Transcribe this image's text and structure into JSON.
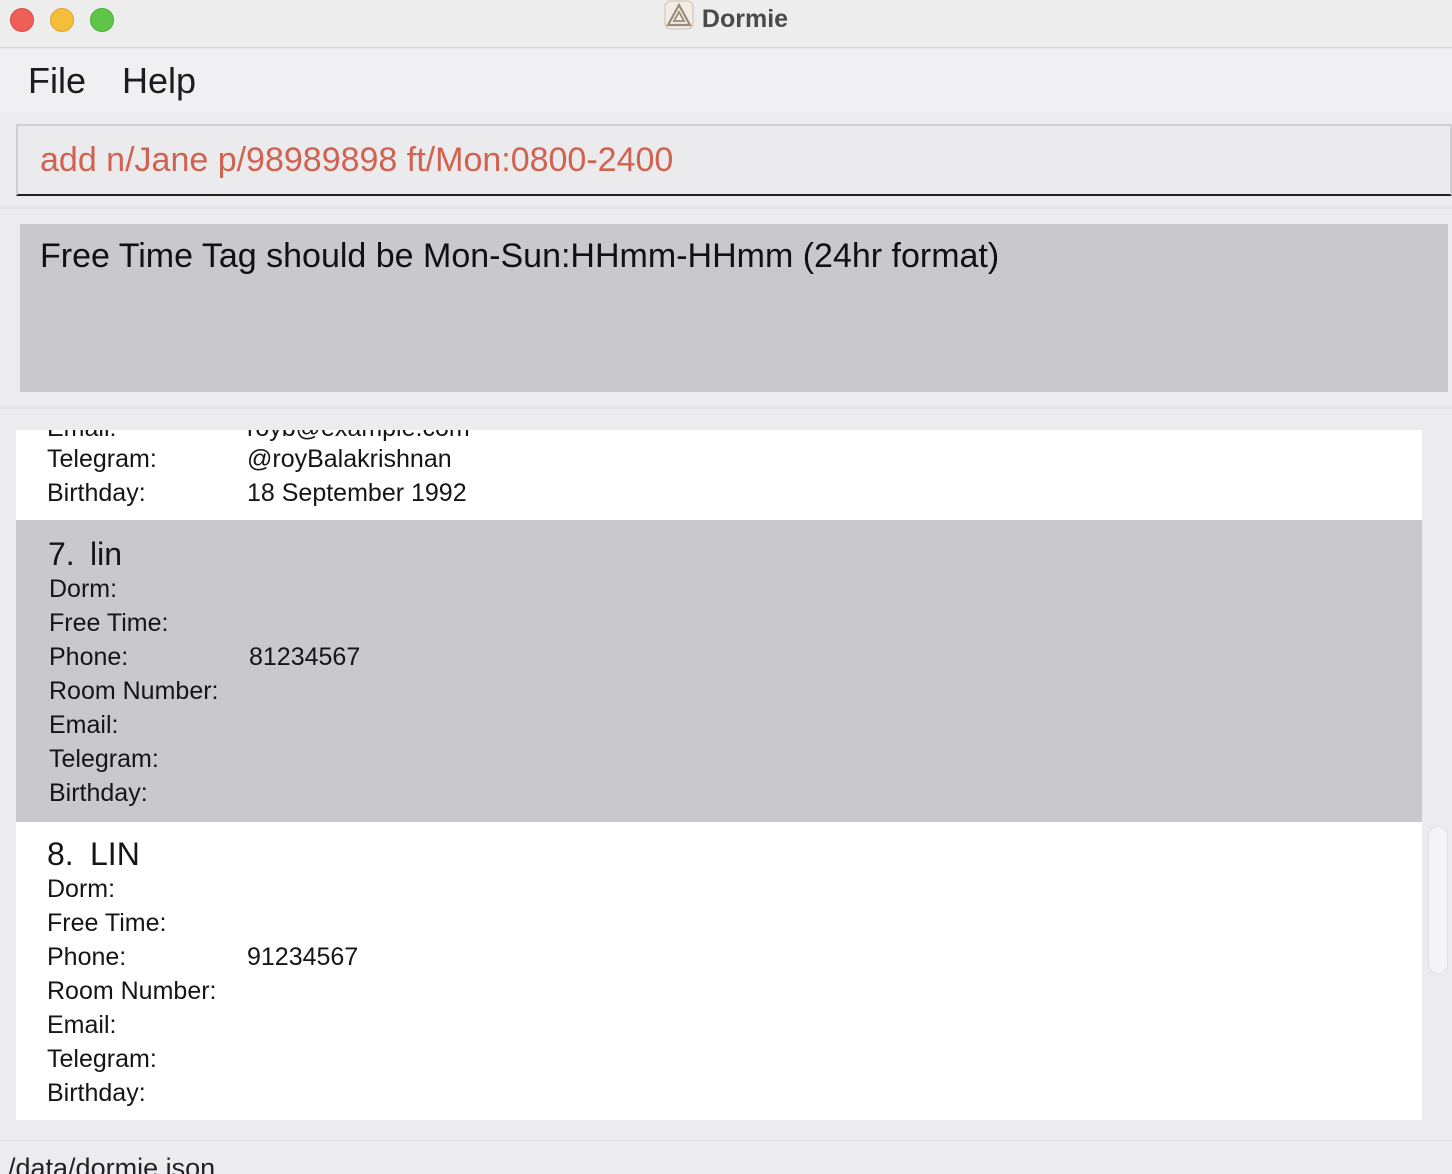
{
  "window": {
    "title": "Dormie"
  },
  "menu": {
    "file": "File",
    "help": "Help"
  },
  "command": {
    "value": "add n/Jane p/98989898 ft/Mon:0800-2400"
  },
  "result": {
    "message": "Free Time Tag should be Mon-Sun:HHmm-HHmm (24hr format)"
  },
  "labels": {
    "dorm": "Dorm:",
    "free_time": "Free Time:",
    "phone": "Phone:",
    "room": "Room Number:",
    "email": "Email:",
    "telegram": "Telegram:",
    "birthday": "Birthday:"
  },
  "partial_card": {
    "email": "royb@example.com",
    "telegram": "@royBalakrishnan",
    "birthday": "18 September 1992"
  },
  "cards": [
    {
      "index": "7.",
      "name": "lin",
      "phone": "81234567"
    },
    {
      "index": "8.",
      "name": "LIN",
      "phone": "91234567"
    }
  ],
  "status": {
    "path": "/data/dormie.json"
  }
}
